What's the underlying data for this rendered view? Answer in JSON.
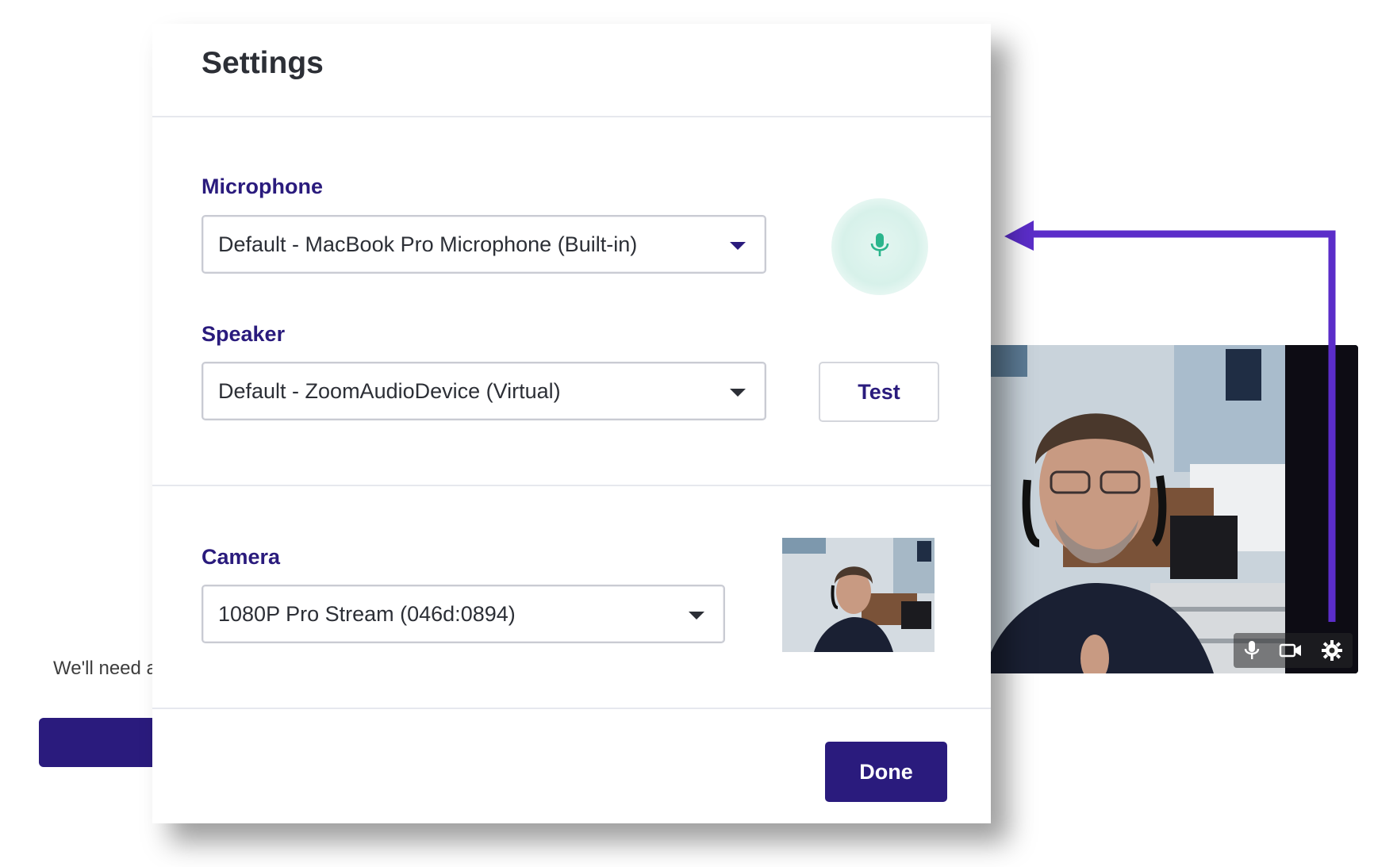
{
  "background": {
    "partial_text": "We'll need a",
    "button_color": "#2a1b7d"
  },
  "modal": {
    "title": "Settings",
    "microphone": {
      "label": "Microphone",
      "selected": "Default - MacBook Pro Microphone (Built-in)",
      "meter_icon": "microphone-icon",
      "meter_color": "#2bb58c"
    },
    "speaker": {
      "label": "Speaker",
      "selected": "Default - ZoomAudioDevice (Virtual)",
      "test_label": "Test"
    },
    "camera": {
      "label": "Camera",
      "selected": "1080P Pro Stream (046d:0894)"
    },
    "done_label": "Done"
  },
  "video_tile": {
    "controls": [
      "microphone-icon",
      "video-camera-icon",
      "gear-icon"
    ]
  },
  "annotation": {
    "arrow_color": "#5b2dc9"
  },
  "colors": {
    "accent": "#2a1b7d",
    "text": "#2c2f36",
    "border": "#c9cbd3"
  }
}
